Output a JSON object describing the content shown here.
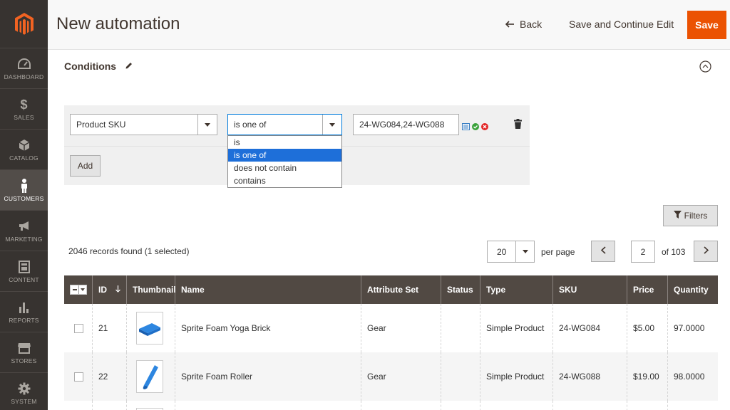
{
  "sidebar": {
    "items": [
      {
        "label": "DASHBOARD",
        "icon": "dashboard-icon"
      },
      {
        "label": "SALES",
        "icon": "dollar-icon"
      },
      {
        "label": "CATALOG",
        "icon": "cube-icon"
      },
      {
        "label": "CUSTOMERS",
        "icon": "person-icon",
        "active": true
      },
      {
        "label": "MARKETING",
        "icon": "megaphone-icon"
      },
      {
        "label": "CONTENT",
        "icon": "layout-icon"
      },
      {
        "label": "REPORTS",
        "icon": "bar-chart-icon"
      },
      {
        "label": "STORES",
        "icon": "store-icon"
      },
      {
        "label": "SYSTEM",
        "icon": "gear-icon"
      }
    ]
  },
  "header": {
    "title": "New automation",
    "back_label": "Back",
    "save_continue_label": "Save and Continue Edit",
    "save_label": "Save"
  },
  "conditions": {
    "title": "Conditions",
    "attribute_select": "Product SKU",
    "operator_select": "is one of",
    "value": "24-WG084,24-WG088",
    "add_label": "Add",
    "operator_options": [
      {
        "label": "is"
      },
      {
        "label": "is one of",
        "selected": true
      },
      {
        "label": "does not contain"
      },
      {
        "label": "contains"
      }
    ]
  },
  "toolbar": {
    "filters_label": "Filters",
    "records_text": "2046 records found (1 selected)",
    "per_page_value": "20",
    "per_page_label": "per page",
    "page_value": "2",
    "page_of": "of 103"
  },
  "grid": {
    "columns": [
      "ID",
      "Thumbnail",
      "Name",
      "Attribute Set",
      "Status",
      "Type",
      "SKU",
      "Price",
      "Quantity"
    ],
    "rows": [
      {
        "id": "21",
        "name": "Sprite Foam Yoga Brick",
        "attribute_set": "Gear",
        "status": "",
        "type": "Simple Product",
        "sku": "24-WG084",
        "price": "$5.00",
        "quantity": "97.0000"
      },
      {
        "id": "22",
        "name": "Sprite Foam Roller",
        "attribute_set": "Gear",
        "status": "",
        "type": "Simple Product",
        "sku": "24-WG088",
        "price": "$19.00",
        "quantity": "98.0000"
      }
    ]
  },
  "colors": {
    "accent": "#eb5202",
    "sidebar_bg": "#373330",
    "grid_header_bg": "#514943",
    "selected_option": "#1e6fd9"
  }
}
